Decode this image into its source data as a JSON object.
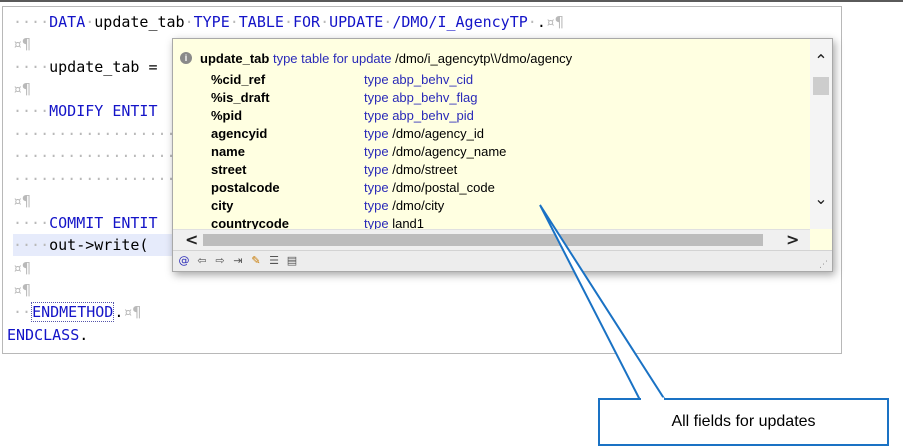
{
  "code": {
    "line1": {
      "dots": "····",
      "kw_data": "DATA",
      "var": "update_tab",
      "kw_type": "TYPE",
      "kw_table": "TABLE",
      "kw_for": "FOR",
      "kw_update": "UPDATE",
      "entity": "/DMO/I_AgencyTP",
      "end": ".",
      "pilcrow": "¤¶"
    },
    "blank_marker": "¤¶",
    "line3": {
      "dots": "····",
      "text": "update_tab ="
    },
    "line5": {
      "dots": "····",
      "kw": "MODIFY ENTIT"
    },
    "dotline": "························",
    "line10": {
      "dots": "····",
      "kw": "COMMIT ENTIT"
    },
    "line11": {
      "dots": "····",
      "text": "out->write("
    },
    "line14": {
      "dots": "··",
      "kw": "ENDMETHOD",
      "end": ".",
      "pilcrow": "¤¶"
    },
    "line15": {
      "kw": "ENDCLASS",
      "end": "."
    }
  },
  "popup": {
    "info_icon": "i",
    "header": {
      "name": "update_tab",
      "type_text": "type table for update",
      "value": "/dmo/i_agencytp\\\\/dmo/agency"
    },
    "type_kw": "type",
    "fields": [
      {
        "name": "%cid_ref",
        "type": "abp_behv_cid"
      },
      {
        "name": "%is_draft",
        "type": "abp_behv_flag"
      },
      {
        "name": "%pid",
        "type": "abp_behv_pid"
      },
      {
        "name": "agencyid",
        "type": "/dmo/agency_id"
      },
      {
        "name": "name",
        "type": "/dmo/agency_name"
      },
      {
        "name": "street",
        "type": "/dmo/street"
      },
      {
        "name": "postalcode",
        "type": "/dmo/postal_code"
      },
      {
        "name": "city",
        "type": "/dmo/city"
      },
      {
        "name": "countrycode",
        "type": "land1"
      }
    ],
    "scroll_up": "⌃",
    "scroll_down": "⌄",
    "scroll_left": "<",
    "scroll_right": ">",
    "toolbar_icons": [
      "@",
      "⇦",
      "⇨",
      "⇥",
      "✎",
      "☰",
      "▤"
    ]
  },
  "callout": {
    "text": "All fields for updates",
    "border_color": "#1a72c4"
  }
}
